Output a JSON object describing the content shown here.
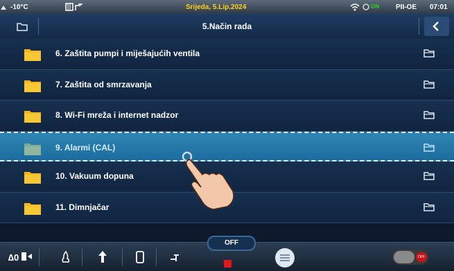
{
  "status_bar": {
    "temperature": "-10°C",
    "date": "Srijeda, 5.Lip.2024",
    "connection_status": "ON",
    "mode": "PII-OE",
    "time": "07:01"
  },
  "header": {
    "title": "5.Način rada"
  },
  "list": {
    "items": [
      {
        "label": "6.  Zaštita pumpi i miješajućih ventila"
      },
      {
        "label": "7.  Zaštita od smrzavanja"
      },
      {
        "label": "8.  Wi-Fi mreža i internet nadzor"
      },
      {
        "label": "9.  Alarmi (CAL)",
        "selected": true
      },
      {
        "label": "10. Vakuum dopuna"
      },
      {
        "label": "11. Dimnjačar"
      }
    ]
  },
  "bottom_bar": {
    "mode_label": "OFF",
    "toggle_label": "OFF"
  },
  "colors": {
    "background": "#0d1a2b",
    "selected_row": "#2f86b4",
    "folder": "#f5b81c",
    "folder_selected": "#8fb6a0",
    "date_text": "#ffd21a",
    "stop": "#e01a1a"
  },
  "icons": [
    "folder-icon",
    "folder-open-icon",
    "back-chevron-icon",
    "wifi-icon",
    "thermometer-icon",
    "tap-hand-icon"
  ]
}
